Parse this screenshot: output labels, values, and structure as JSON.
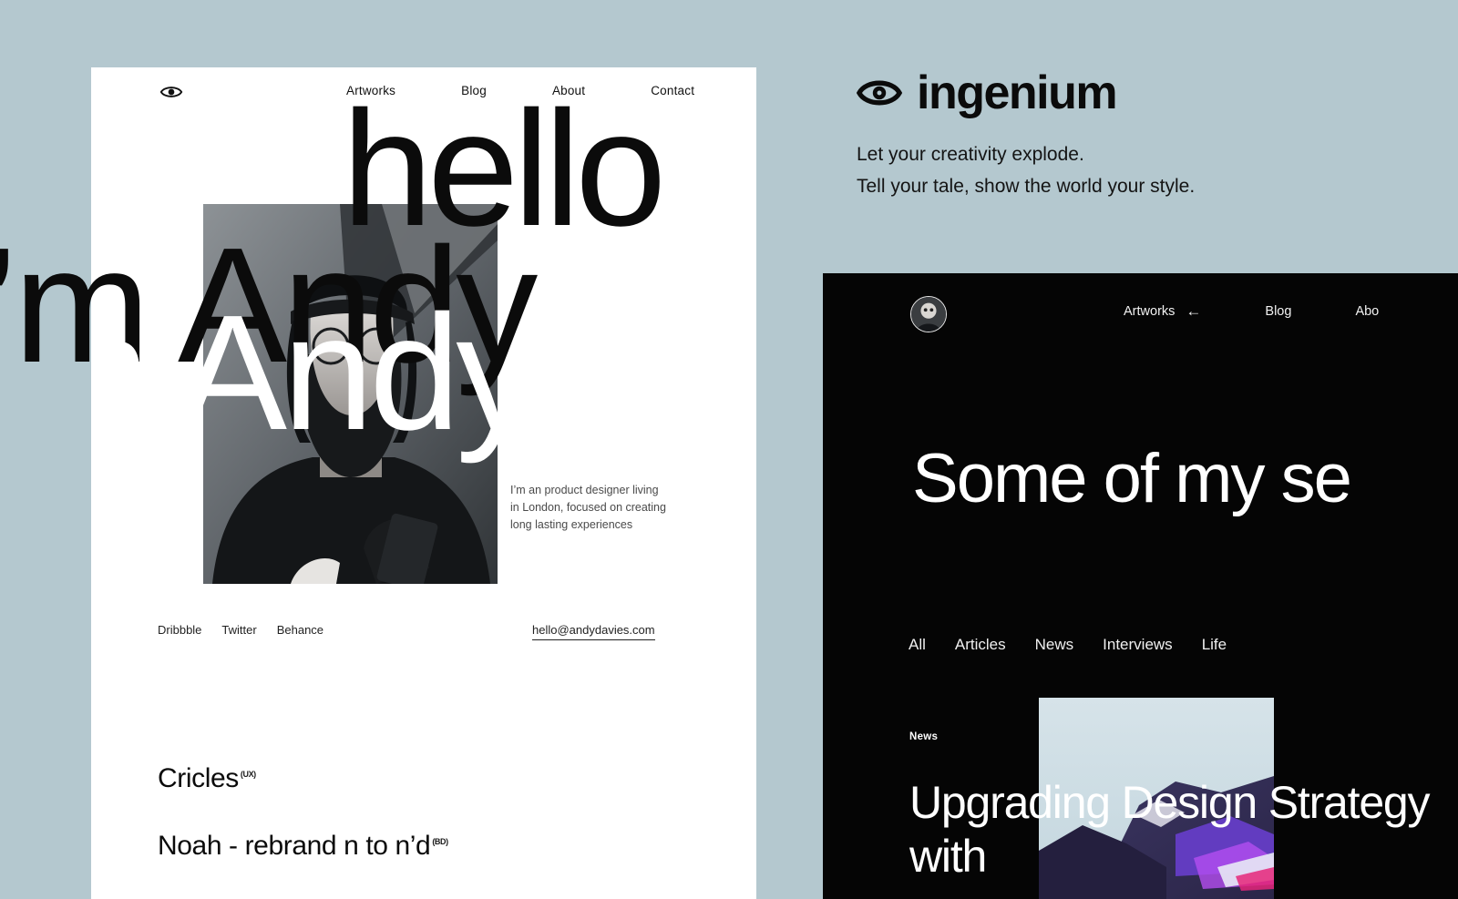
{
  "theme": {
    "page_background": "#b4c8cf",
    "card_background": "#ffffff",
    "dark_card_background": "#050505",
    "text_dark": "#0b0b0b",
    "text_light": "#ffffff"
  },
  "brand": {
    "icon": "eye-icon",
    "name": "ingenium",
    "tagline_line1": "Let your creativity explode.",
    "tagline_line2": "Tell your tale, show the world your style."
  },
  "portfolio_card": {
    "logo_icon": "eye-icon",
    "nav": [
      {
        "label": "Artworks"
      },
      {
        "label": "Blog"
      },
      {
        "label": "About"
      },
      {
        "label": "Contact"
      }
    ],
    "display_line1": "hello",
    "display_line2": "I’m Andy",
    "bio": "I’m an product designer living in London, focused on creating long lasting experiences",
    "socials": [
      {
        "label": "Dribbble"
      },
      {
        "label": "Twitter"
      },
      {
        "label": "Behance"
      }
    ],
    "email": "hello@andydavies.com",
    "projects": [
      {
        "title": "Cricles",
        "tag": "(UX)"
      },
      {
        "title": "Noah - rebrand n to n’d",
        "tag": "(BD)"
      }
    ]
  },
  "blog_card": {
    "avatar": "avatar-image",
    "nav": [
      {
        "label": "Artworks",
        "icon": "arrow-left-icon"
      },
      {
        "label": "Blog",
        "icon": ""
      },
      {
        "label": "Abo",
        "icon": ""
      }
    ],
    "heading": "Some of my se",
    "filters": [
      {
        "label": "All"
      },
      {
        "label": "Articles"
      },
      {
        "label": "News"
      },
      {
        "label": "Interviews"
      },
      {
        "label": "Life"
      }
    ],
    "article": {
      "category": "News",
      "title": "Upgrading Design Strategy with"
    }
  }
}
